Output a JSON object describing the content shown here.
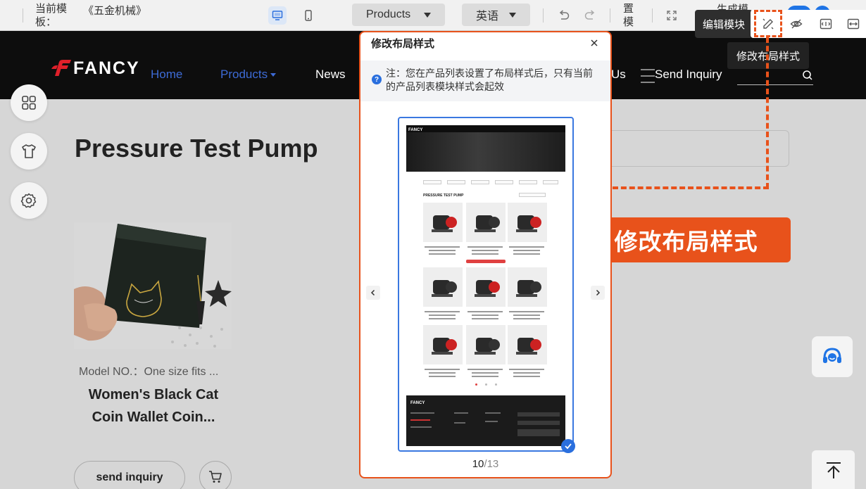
{
  "toolbar": {
    "template_label": "当前模板：",
    "template_name": "《五金机械》",
    "page_select": "Products",
    "language_select": "英语",
    "vtext_a": "置模",
    "vtext_b": "生成模",
    "edit_module_tip": "编辑模块",
    "layout_tip": "修改布局样式",
    "icons": [
      "desktop-icon",
      "mobile-icon",
      "undo-icon",
      "redo-icon",
      "fullscreen-icon",
      "layout-edit-icon",
      "hide-icon",
      "width-icon",
      "expand-icon"
    ]
  },
  "site": {
    "logo_text": "FANCY",
    "nav": [
      "Home",
      "Products",
      "News",
      "Us",
      "Send Inquiry"
    ],
    "brand_red": "#e0202a",
    "nav_active_color": "#3d6bd6"
  },
  "page": {
    "title": "Pressure Test Pump",
    "product": {
      "model": "Model NO.：One size fits ...",
      "name": "Women's Black Cat Coin Wallet Coin...",
      "inquiry_button": "send inquiry"
    }
  },
  "callout": {
    "text": "修改布局样式",
    "color": "#e8521b"
  },
  "modal": {
    "title": "修改布局样式",
    "notice": "注：您在产品列表设置了布局样式后，只有当前的产品列表模块样式会起效",
    "pager": {
      "current": "10",
      "total": "/13"
    },
    "preview": {
      "logo": "FANCY",
      "heading": "PRESSURE TEST PUMP",
      "footer_logo": "FANCY"
    }
  }
}
